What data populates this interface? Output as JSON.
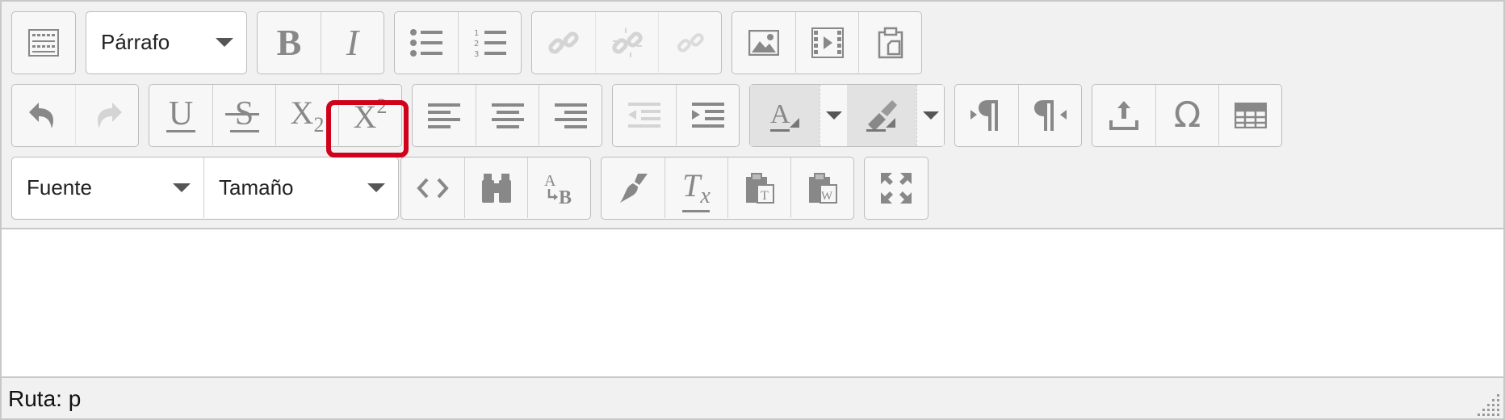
{
  "toolbar": {
    "format_select": {
      "value": "Párrafo"
    },
    "font_select": {
      "value": "Fuente"
    },
    "size_select": {
      "value": "Tamaño"
    },
    "buttons": {
      "toggle_toolbar": "toolbar-toggle-icon",
      "bold": "B",
      "italic": "I",
      "underline": "U",
      "strikethrough": "S",
      "subscript_base": "X",
      "subscript_index": "2",
      "superscript_base": "X",
      "superscript_index": "2",
      "clear_format_letter": "T",
      "clear_format_sub": "x",
      "spell_a": "A",
      "spell_b": "B"
    },
    "highlight_color": "#d0021b"
  },
  "statusbar": {
    "path": "Ruta: p"
  }
}
